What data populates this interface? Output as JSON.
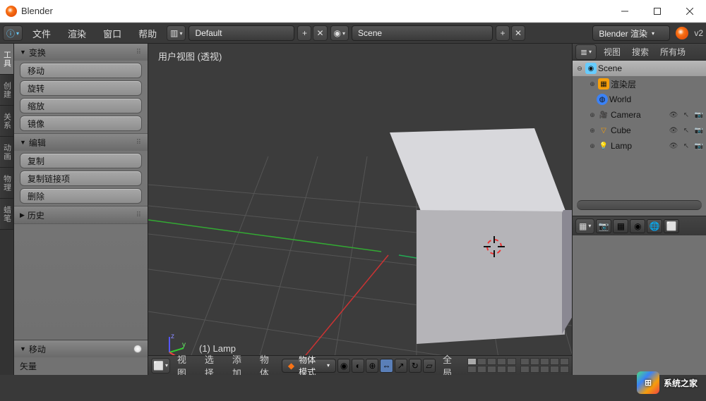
{
  "window": {
    "title": "Blender"
  },
  "topbar": {
    "menus": [
      "文件",
      "渲染",
      "窗口",
      "帮助"
    ],
    "layout_field": "Default",
    "scene_field": "Scene",
    "engine_field": "Blender 渲染",
    "version": "v2"
  },
  "left_tabs": [
    "工具",
    "创建",
    "关系",
    "动画",
    "物理",
    "蜡笔"
  ],
  "tool_panel": {
    "transform": {
      "header": "变换",
      "items": [
        "移动",
        "旋转",
        "缩放",
        "镜像"
      ]
    },
    "edit": {
      "header": "编辑",
      "items": [
        "复制",
        "复制链接项",
        "删除"
      ]
    },
    "history": {
      "header": "历史"
    },
    "bottom": {
      "header": "移动",
      "vec_label": "矢量"
    }
  },
  "viewport": {
    "label": "用户视图  (透视)",
    "active_object": "(1) Lamp",
    "header": {
      "menus": [
        "视图",
        "选择",
        "添加",
        "物体"
      ],
      "mode": "物体模式",
      "snap_label": "全局"
    }
  },
  "outliner": {
    "head": [
      "视图",
      "搜索",
      "所有场"
    ],
    "scene": "Scene",
    "items": [
      {
        "name": "渲染层",
        "icon": "layers",
        "color": "#f59e0b"
      },
      {
        "name": "World",
        "icon": "world",
        "color": "#3b82f6"
      },
      {
        "name": "Camera",
        "icon": "camera",
        "color": "#f97316"
      },
      {
        "name": "Cube",
        "icon": "cube",
        "color": "#f59e0b"
      },
      {
        "name": "Lamp",
        "icon": "lamp",
        "color": "#fbbf24"
      }
    ]
  },
  "watermark": "系统之家"
}
